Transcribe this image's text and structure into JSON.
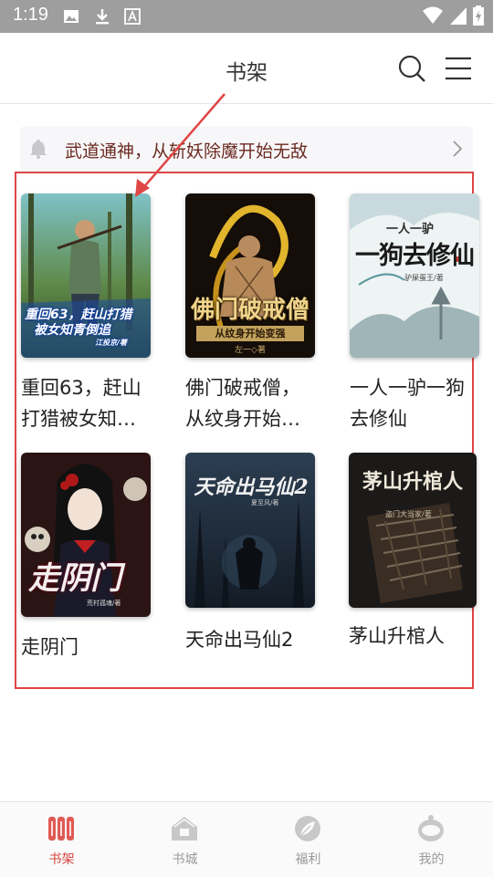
{
  "status_bar": {
    "time": "1:19"
  },
  "header": {
    "title": "书架"
  },
  "notice": {
    "text": "武道通神，从斩妖除魔开始无敌"
  },
  "books": [
    {
      "title": "重回63，赶山打猎被女知青倒追",
      "cover_text": {
        "line1": "重回63，赶山打猎",
        "line2": "被女知青倒追",
        "author": "江投京/著"
      }
    },
    {
      "title": "佛门破戒僧，从纹身开始变强",
      "cover_text": {
        "line1": "佛门破戒僧",
        "line2": "从纹身开始变强",
        "author": "左一◇著"
      }
    },
    {
      "title": "一人一驴一狗去修仙",
      "cover_text": {
        "line1": "一人一驴",
        "line2": "一狗去修仙",
        "author": "驴屎蛋王/著"
      }
    },
    {
      "title": "走阴门",
      "cover_text": {
        "line1": "走阴门",
        "author": "荒村孤魂/著"
      }
    },
    {
      "title": "天命出马仙2",
      "cover_text": {
        "line1": "天命出马仙2",
        "author": "夏至风/著"
      }
    },
    {
      "title": "茅山升棺人",
      "cover_text": {
        "line1": "茅山升棺人",
        "author": "盗门大当家/著"
      }
    }
  ],
  "bottom_nav": [
    {
      "label": "书架",
      "active": true
    },
    {
      "label": "书城",
      "active": false
    },
    {
      "label": "福利",
      "active": false
    },
    {
      "label": "我的",
      "active": false
    }
  ],
  "colors": {
    "accent": "#d9443d",
    "annotation": "#e04646",
    "status_bar": "#9e9e9e"
  }
}
